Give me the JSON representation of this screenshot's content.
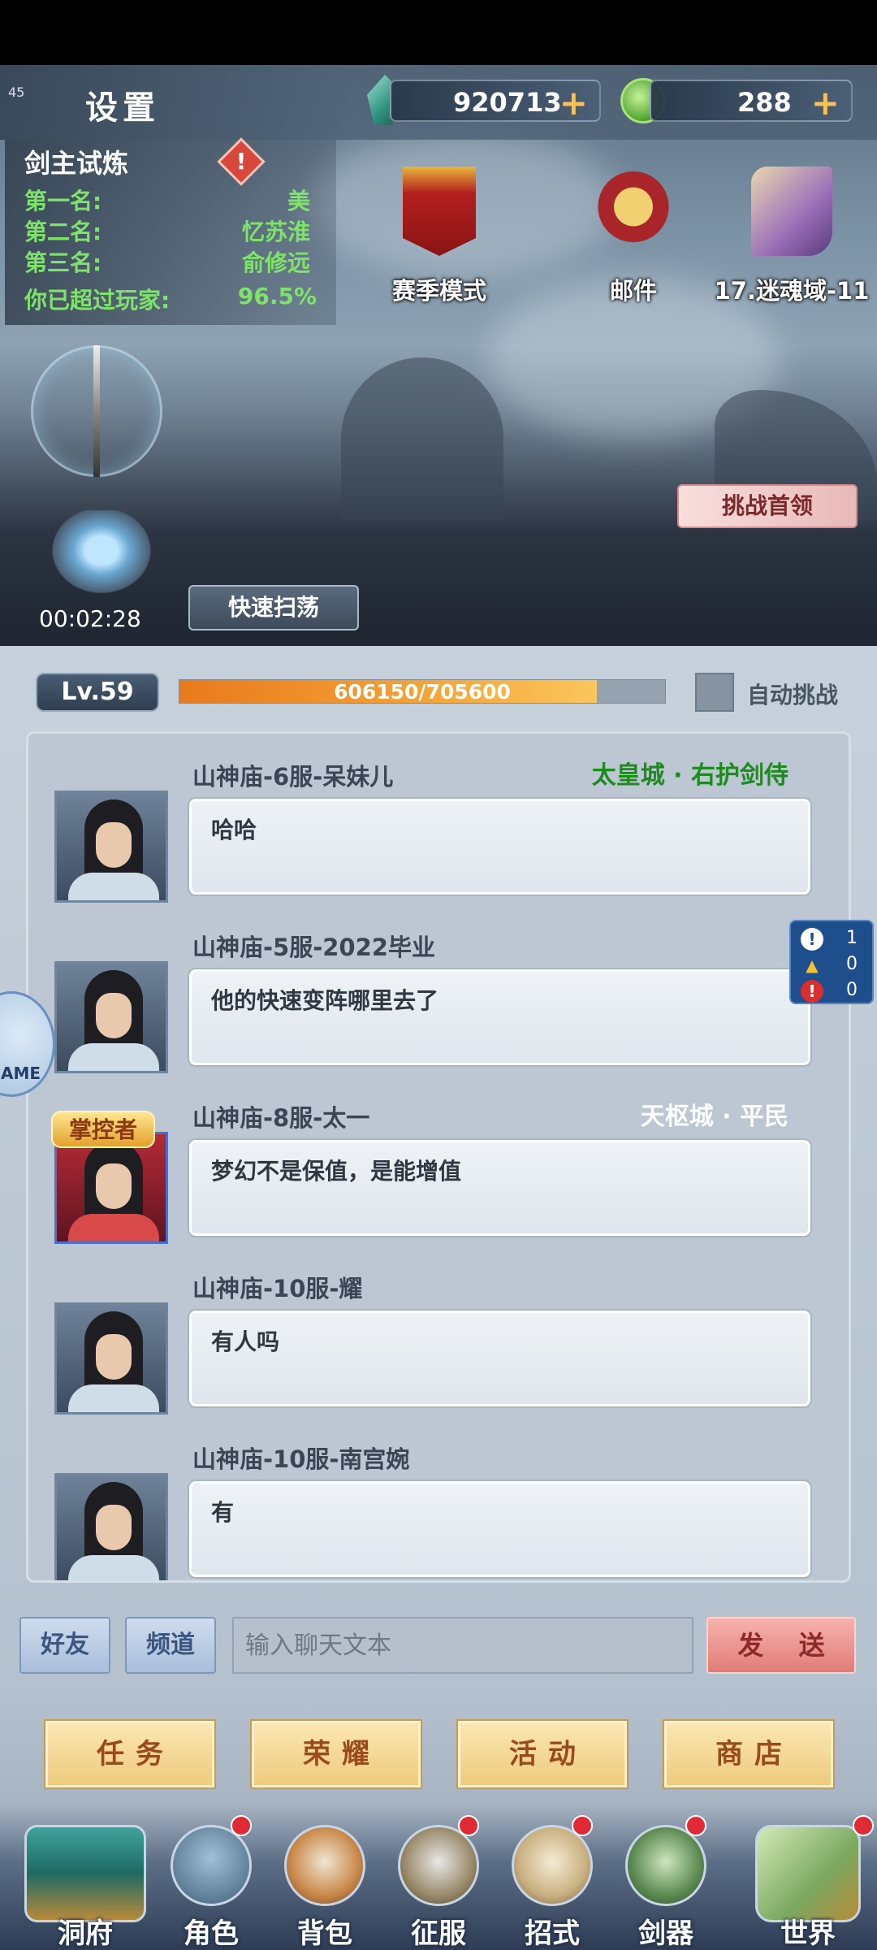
{
  "header": {
    "fps": "45",
    "title": "设置",
    "gems": "920713",
    "jade": "288",
    "plus": "+"
  },
  "leaderboard": {
    "title": "剑主试炼",
    "alert": "!",
    "rows": [
      {
        "label": "第一名:",
        "value": "美"
      },
      {
        "label": "第二名:",
        "value": "忆苏淮"
      },
      {
        "label": "第三名:",
        "value": "俞修远"
      },
      {
        "label": "你已超过玩家:",
        "value": "96.5%"
      }
    ]
  },
  "shortcuts": {
    "season": "赛季模式",
    "mail": "邮件",
    "stage": "17.迷魂域-11"
  },
  "battle": {
    "challenge": "挑战首领",
    "timer": "00:02:28",
    "sweep": "快速扫荡"
  },
  "progress": {
    "level": "Lv.59",
    "xp_text": "606150/705600",
    "xp_fraction": 0.859,
    "auto_label": "自动挑战"
  },
  "chat": {
    "messages": [
      {
        "sender": "山神庙-6服-呆妹儿",
        "title": "太皇城 · 右护剑侍",
        "title_color": "#1f8a1f",
        "text": "哈哈",
        "badge": ""
      },
      {
        "sender": "山神庙-5服-2022毕业",
        "title": "",
        "title_color": "#ffffff",
        "text": "他的快速变阵哪里去了",
        "badge": ""
      },
      {
        "sender": "山神庙-8服-太一",
        "title": "天枢城 · 平民",
        "title_color": "#ffffff",
        "text": "梦幻不是保值，是能增值",
        "badge": "掌控者"
      },
      {
        "sender": "山神庙-10服-耀",
        "title": "",
        "title_color": "#ffffff",
        "text": "有人吗",
        "badge": ""
      },
      {
        "sender": "山神庙-10服-南宫婉",
        "title": "",
        "title_color": "#ffffff",
        "text": "有",
        "badge": ""
      }
    ],
    "tabs": {
      "friends": "好友",
      "channel": "频道"
    },
    "placeholder": "输入聊天文本",
    "send": "发 送"
  },
  "alerts": {
    "info": "1",
    "warning": "0",
    "error": "0"
  },
  "float_logo": "AME",
  "quick_menu": [
    "任务",
    "荣耀",
    "活动",
    "商店"
  ],
  "nav": [
    "洞府",
    "角色",
    "背包",
    "征服",
    "招式",
    "剑器",
    "世界"
  ]
}
